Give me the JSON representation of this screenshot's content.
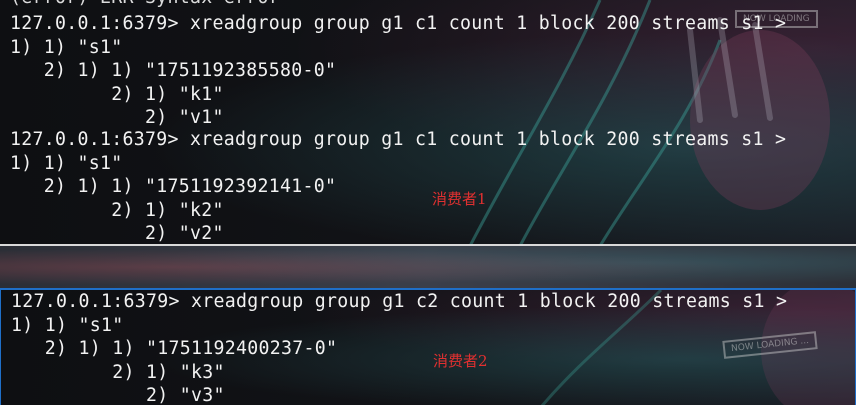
{
  "pane1": {
    "partial_top": "(error) ERR Syntax error",
    "lines": [
      "127.0.0.1:6379> xreadgroup group g1 c1 count 1 block 200 streams s1 >",
      "1) 1) \"s1\"",
      "   2) 1) 1) \"1751192385580-0\"",
      "         2) 1) \"k1\"",
      "            2) \"v1\"",
      "127.0.0.1:6379> xreadgroup group g1 c1 count 1 block 200 streams s1 >",
      "1) 1) \"s1\"",
      "   2) 1) 1) \"1751192392141-0\"",
      "         2) 1) \"k2\"",
      "            2) \"v2\""
    ],
    "annotation": "消费者1"
  },
  "pane2": {
    "lines": [
      "127.0.0.1:6379> xreadgroup group g1 c2 count 1 block 200 streams s1 >",
      "1) 1) \"s1\"",
      "   2) 1) 1) \"1751192400237-0\"",
      "         2) 1) \"k3\"",
      "            2) \"v3\""
    ],
    "annotation": "消费者2",
    "badge": "NOW LOADING ..."
  },
  "colors": {
    "text": "#f2f2f2",
    "annotation": "#e03030",
    "active_border": "#1f6fc8"
  }
}
